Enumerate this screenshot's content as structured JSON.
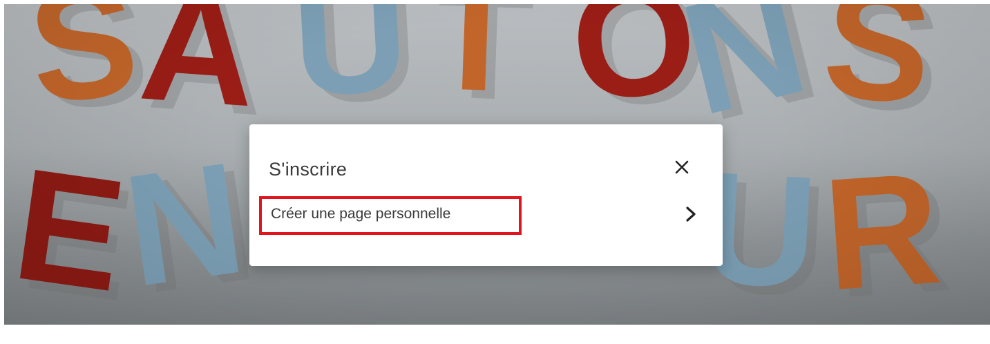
{
  "background": {
    "letters": [
      {
        "char": "S",
        "color": "#c2652a"
      },
      {
        "char": "A",
        "color": "#9a1d16"
      },
      {
        "char": "U",
        "color": "#7c9fb5"
      },
      {
        "char": "T",
        "color": "#c2652a"
      },
      {
        "char": "O",
        "color": "#9a1d16"
      },
      {
        "char": "N",
        "color": "#7c9fb5"
      },
      {
        "char": "S",
        "color": "#c2652a"
      },
      {
        "char": "E",
        "color": "#8e1a14"
      },
      {
        "char": "N",
        "color": "#7c9fb5"
      },
      {
        "char": "U",
        "color": "#7c9fb5"
      },
      {
        "char": "R",
        "color": "#c2652a"
      }
    ]
  },
  "modal": {
    "title": "S'inscrire",
    "close_icon": "close-icon",
    "option": {
      "label": "Créer une page personnelle",
      "icon": "chevron-right-icon",
      "highlight_color": "#e2151e"
    }
  }
}
